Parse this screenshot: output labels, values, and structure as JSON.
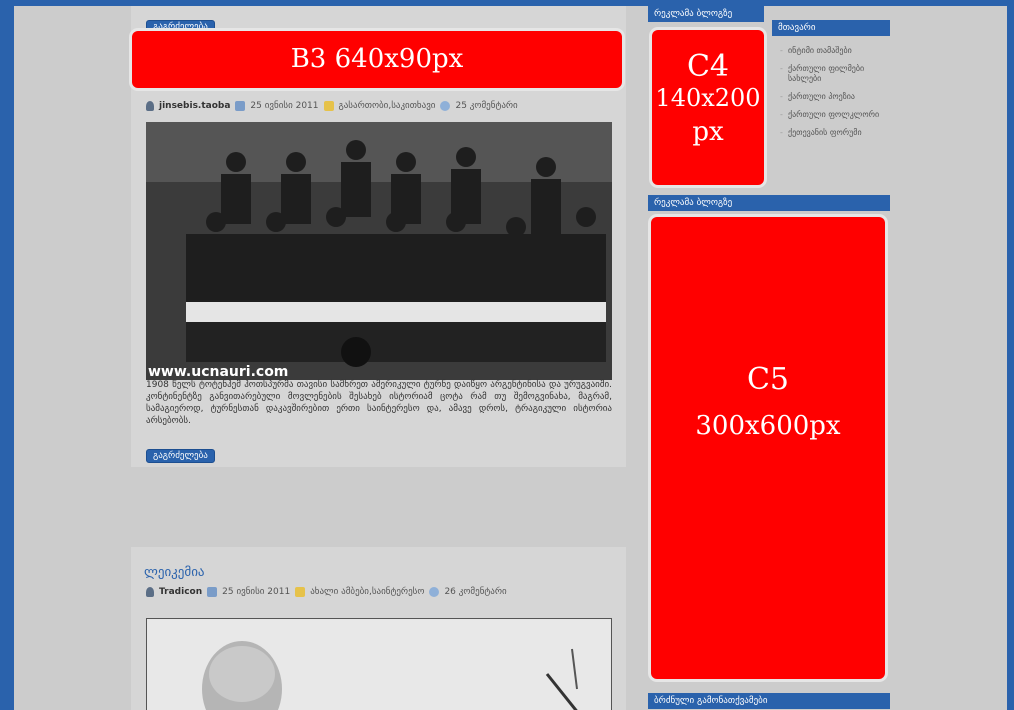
{
  "post1": {
    "more_label_top": "გაგრძელება",
    "ad_b3": "B3  640x90px",
    "author": "jinsebis.taoba",
    "date": "25 ივნისი 2011",
    "category": "გასართობი,საკითხავი",
    "comments": "25 კომენტარი",
    "watermark": "www.ucnauri.com",
    "caption": "1908 წელს ტოტენჰემ ჰოთსპურმა თავისი სამხრეთ ამერიკული ტურნე დაიწყო არგენტინისა და ურუგვაიში. კონტინენტზე განვითარებული მოვლენების შესახებ ისტორიამ ცოტა რამ თუ შემოგვინახა, მაგრამ, სამაგიეროდ, ტურნესთან დაკავშირებით ერთი საინტერესო და, ამავე დროს, ტრაგიკული ისტორია არსებობს.",
    "more_label_bottom": "გაგრძელება"
  },
  "post2": {
    "title": "ლეიკემია",
    "author": "Tradicon",
    "date": "25 ივნისი 2011",
    "category": "ახალი ამბები,საინტერესო",
    "comments": "26 კომენტარი"
  },
  "sidebar": {
    "ad_head_1": "რეკლამა ბლოგზე",
    "ad_c4_line1": "C4",
    "ad_c4_line2": "140x200",
    "ad_c4_line3": "px",
    "ad_head_2": "რეკლამა ბლოგზე",
    "ad_c5_line1": "C5",
    "ad_c5_line2": "300x600px",
    "ad_head_3": "ბრძნული გამონათქვამები",
    "menu_head": "მთავარი",
    "menu_items": [
      "ინტიმი თამაშები",
      "ქართული ფილმები სახლები",
      "ქართული პოეზია",
      "ქართული ფოლკლორი",
      "ქეთევანის ფორუმი"
    ]
  },
  "colors": {
    "frame": "#2a62ac",
    "ad": "#ff0000",
    "page": "#cccccc"
  }
}
